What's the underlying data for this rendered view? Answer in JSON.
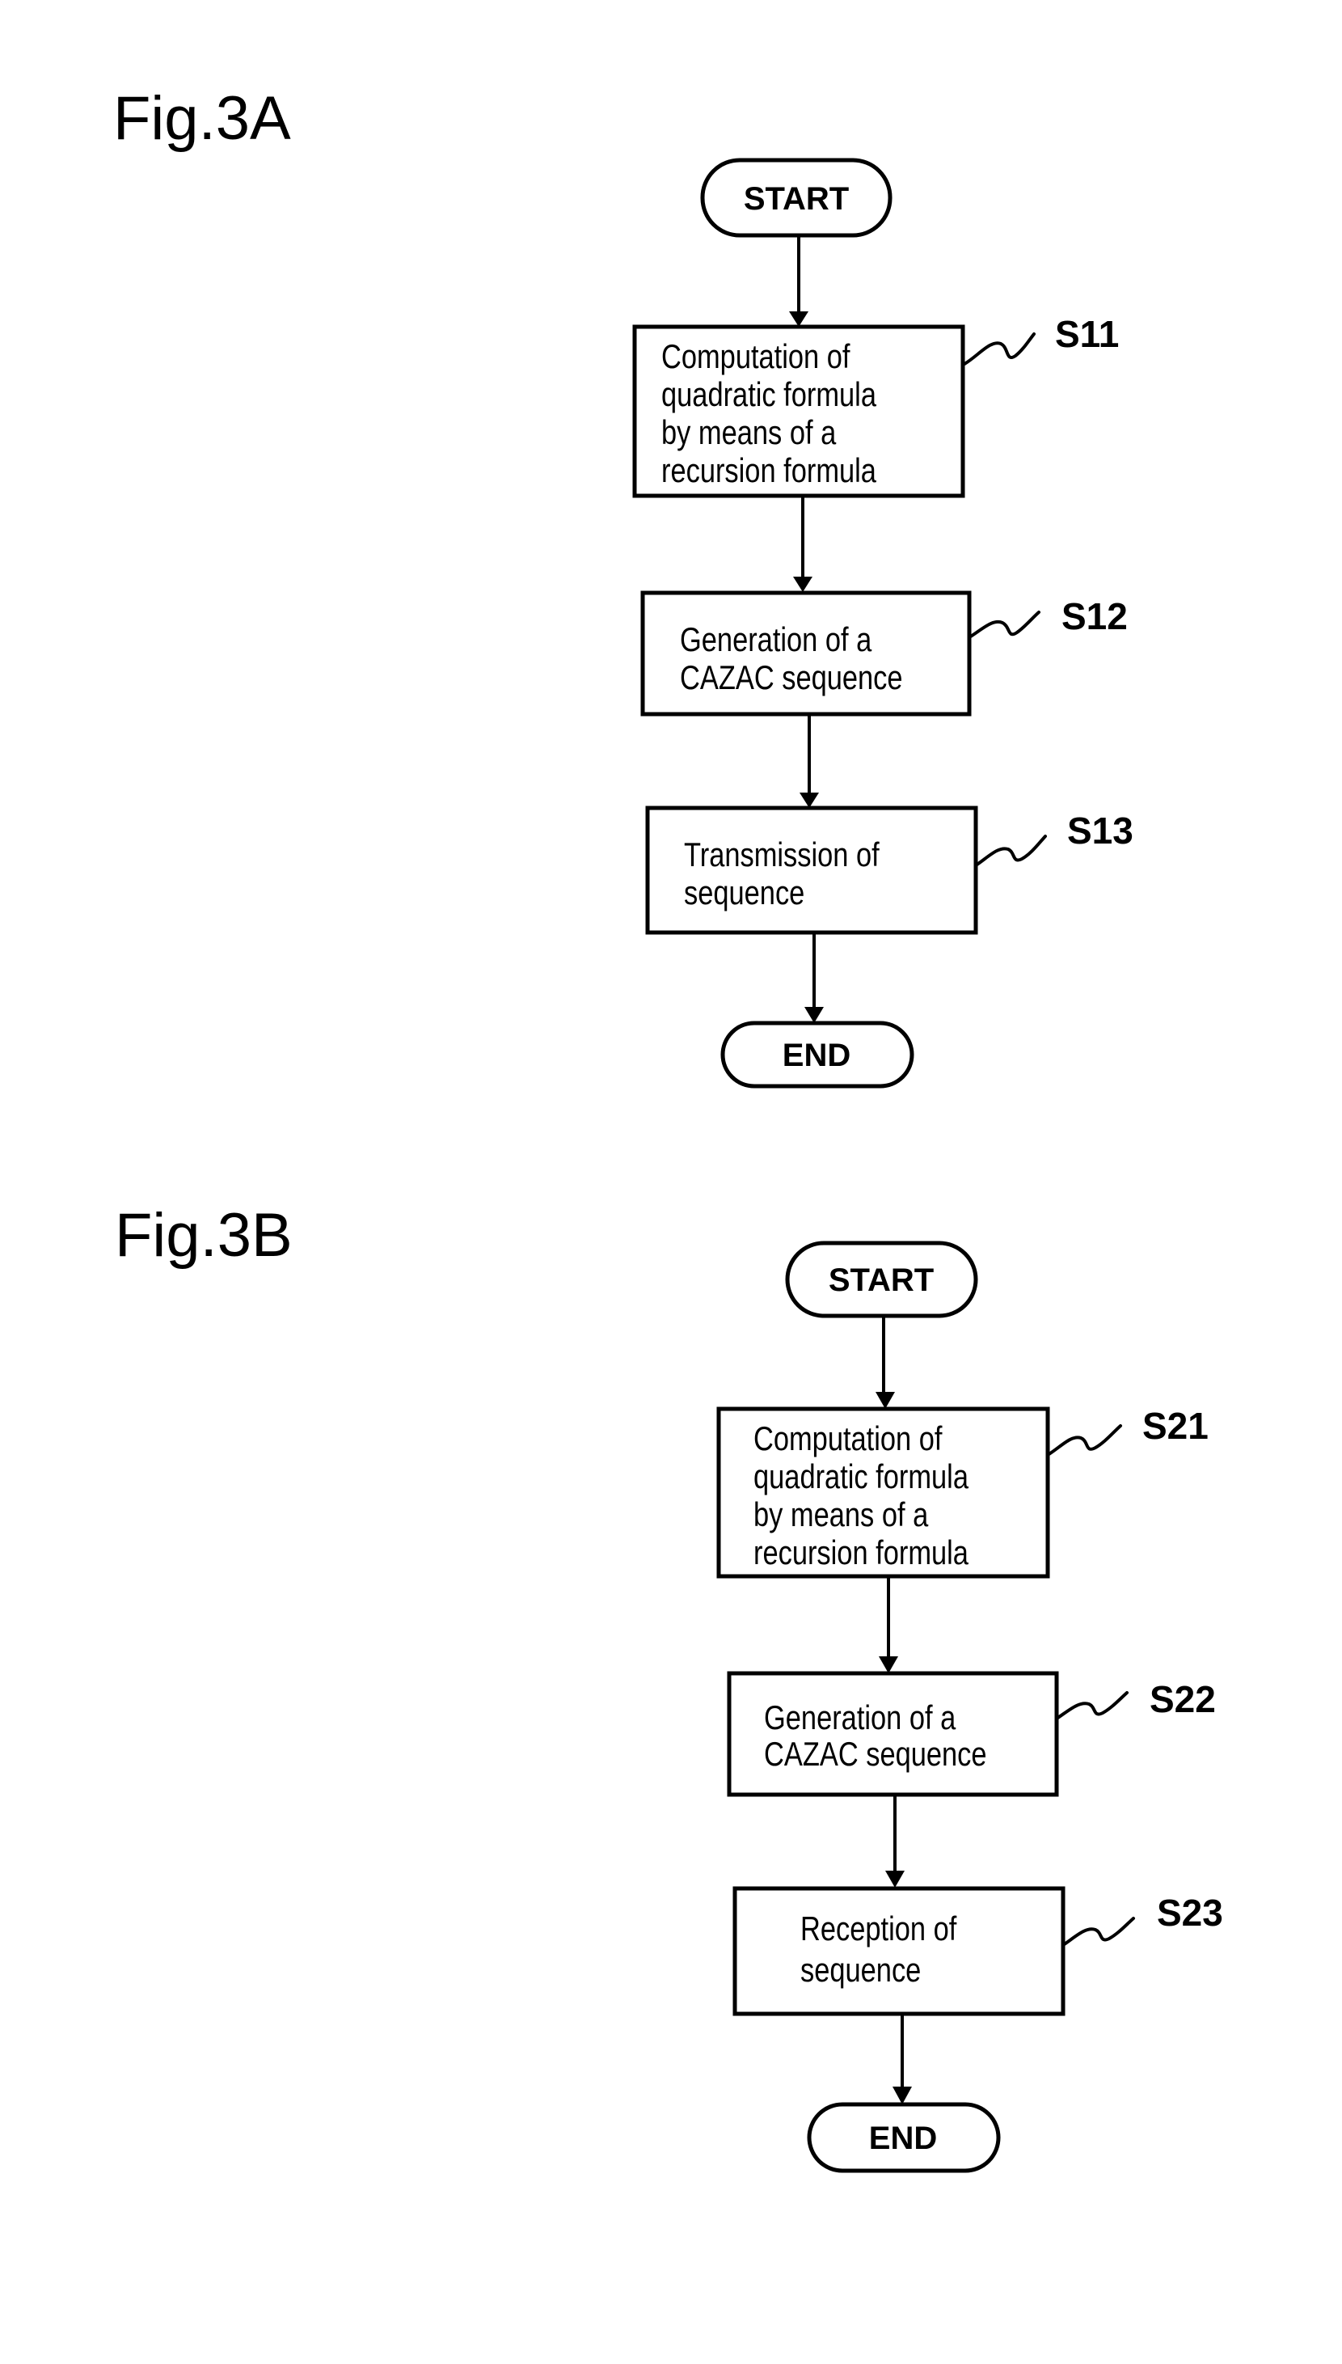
{
  "figures": [
    {
      "title": "Fig.3A",
      "start": "START",
      "end": "END",
      "steps": [
        {
          "id": "S11",
          "lines": [
            "Computation of",
            "quadratic formula",
            "by means of a",
            "recursion formula"
          ]
        },
        {
          "id": "S12",
          "lines": [
            "Generation of a",
            "CAZAC sequence"
          ]
        },
        {
          "id": "S13",
          "lines": [
            "Transmission of",
            "sequence"
          ]
        }
      ]
    },
    {
      "title": "Fig.3B",
      "start": "START",
      "end": "END",
      "steps": [
        {
          "id": "S21",
          "lines": [
            "Computation of",
            "quadratic formula",
            "by means of a",
            "recursion formula"
          ]
        },
        {
          "id": "S22",
          "lines": [
            "Generation of a",
            "CAZAC sequence"
          ]
        },
        {
          "id": "S23",
          "lines": [
            "Reception of",
            "sequence"
          ]
        }
      ]
    }
  ]
}
